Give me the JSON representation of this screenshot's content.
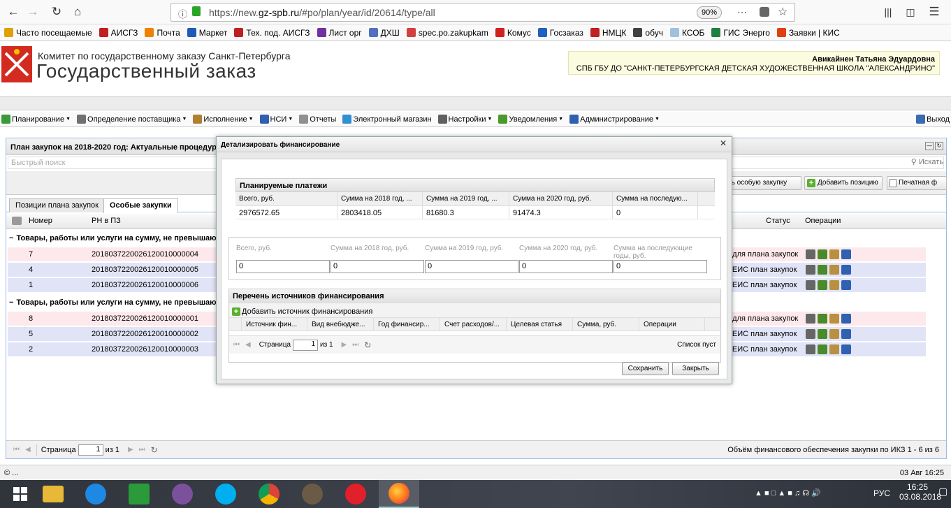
{
  "browser": {
    "url_prefix": "https://new.",
    "url_domain": "gz-spb.ru",
    "url_rest": "/#po/plan/year/id/20614/type/all",
    "zoom": "90%",
    "bookmarks": [
      {
        "label": "Часто посещаемые",
        "color": "#e0a000"
      },
      {
        "label": "АИСГЗ",
        "color": "#c02020"
      },
      {
        "label": "Почта",
        "color": "#f08000"
      },
      {
        "label": "Маркет",
        "color": "#1e5bb8"
      },
      {
        "label": "Тех. под. АИСГЗ",
        "color": "#c02020"
      },
      {
        "label": "Лист орг",
        "color": "#7030a0"
      },
      {
        "label": "ДХШ",
        "color": "#5070c0"
      },
      {
        "label": "spec.po.zakupkam",
        "color": "#d04040"
      },
      {
        "label": "Комус",
        "color": "#d02020"
      },
      {
        "label": "Госзаказ",
        "color": "#2060c0"
      },
      {
        "label": "НМЦК",
        "color": "#c02020"
      },
      {
        "label": "обуч",
        "color": "#404040"
      },
      {
        "label": "КСОБ",
        "color": "#a0c0e0"
      },
      {
        "label": "ГИС Энерго",
        "color": "#208040"
      },
      {
        "label": "Заявки | КИС",
        "color": "#e04010"
      }
    ]
  },
  "header": {
    "org_line1": "Комитет по государственному заказу Санкт-Петербурга",
    "org_line2": "Государственный заказ",
    "user_name": "Авикайнен Татьяна Эдуардовна",
    "user_org": "СПБ ГБУ ДО \"САНКТ-ПЕТЕРБУРГСКАЯ ДЕТСКАЯ ХУДОЖЕСТВЕННАЯ ШКОЛА \"АЛЕКСАНДРИНО\""
  },
  "menu": {
    "items": [
      {
        "label": "Планирование",
        "caret": true,
        "color": "#3a9a3a"
      },
      {
        "label": "Определение поставщика",
        "caret": true,
        "color": "#707070"
      },
      {
        "label": "Исполнение",
        "caret": true,
        "color": "#b08030"
      },
      {
        "label": "НСИ",
        "caret": true,
        "color": "#3060b0"
      },
      {
        "label": "Отчеты",
        "caret": false,
        "color": "#909090"
      },
      {
        "label": "Электронный магазин",
        "caret": false,
        "color": "#3090d0"
      },
      {
        "label": "Настройки",
        "caret": true,
        "color": "#606060"
      },
      {
        "label": "Уведомления",
        "caret": true,
        "color": "#4a9a2a"
      },
      {
        "label": "Администрирование",
        "caret": true,
        "color": "#3060b0"
      }
    ],
    "exit_label": "Выход"
  },
  "main": {
    "title": "План закупок на 2018-2020 год: Актуальные процедур",
    "search_placeholder": "Быстрый поиск",
    "search_button": "Искать",
    "buttons": {
      "special": "ть особую закупку",
      "add_position": "Добавить позицию",
      "print": "Печатная ф"
    },
    "tabs": [
      "Позиции плана закупок",
      "Особые закупки"
    ],
    "active_tab": 1,
    "columns": {
      "number": "Номер",
      "rn": "РН в ПЗ",
      "status": "Статус",
      "ops": "Операции"
    },
    "groups": [
      {
        "label": "Товары, работы или услуги на сумму, не превышающ",
        "rows": [
          {
            "num": "7",
            "rn": "20180372200261200100000​04",
            "status": "е для плана закупок",
            "tone": "pink"
          },
          {
            "num": "4",
            "rn": "2018037220026120010000005",
            "status": "в ЕИС план закупок",
            "tone": "blue"
          },
          {
            "num": "1",
            "rn": "2018037220026120010000006",
            "status": "в ЕИС план закупок",
            "tone": "blue"
          }
        ]
      },
      {
        "label": "Товары, работы или услуги на сумму, не превышающ",
        "rows": [
          {
            "num": "8",
            "rn": "2018037220026120010000001",
            "status": "е для плана закупок",
            "tone": "pink"
          },
          {
            "num": "5",
            "rn": "2018037220026120010000002",
            "status": "в ЕИС план закупок",
            "tone": "blue"
          },
          {
            "num": "2",
            "rn": "2018037220026120010000003",
            "status": "в ЕИС план закупок",
            "tone": "blue"
          }
        ]
      }
    ],
    "pager": {
      "page_label": "Страница",
      "page": "1",
      "of": "из 1",
      "summary": "Объём финансового обеспечения закупки по ИКЗ 1 - 6 из 6"
    }
  },
  "modal": {
    "title": "Детализировать финансирование",
    "planned": {
      "heading": "Планируемые платежи",
      "columns": [
        "Всего, руб.",
        "Сумма на 2018 год, ...",
        "Сумма на 2019 год, ...",
        "Сумма на 2020 год, руб.",
        "Сумма на последую..."
      ],
      "values": [
        "2976572.65",
        "2803418.05",
        "81680.3",
        "91474.3",
        "0"
      ]
    },
    "form": {
      "labels": [
        "Всего, руб.",
        "Сумма на 2018 год, руб.",
        "Сумма на 2019 год, руб.",
        "Сумма на 2020 год, руб.",
        "Сумма на последующие годы, руб."
      ],
      "values": [
        "0",
        "0",
        "0",
        "0",
        "0"
      ]
    },
    "sources": {
      "heading": "Перечень источников финансирования",
      "add_label": "Добавить источник финансирования",
      "columns": [
        "Источник фин...",
        "Вид внебюдже...",
        "Год финансир...",
        "Счет расходов/...",
        "Целевая статья",
        "Сумма, руб.",
        "Операции"
      ],
      "pager_label": "Страница",
      "page": "1",
      "of": "из 1",
      "empty": "Список пуст"
    },
    "save_label": "Сохранить",
    "close_label": "Закрыть"
  },
  "statusbar": {
    "left": "© ...",
    "right": "03 Авг 16:25"
  },
  "taskbar": {
    "lang": "РУС",
    "time": "16:25",
    "date": "03.08.2018"
  }
}
